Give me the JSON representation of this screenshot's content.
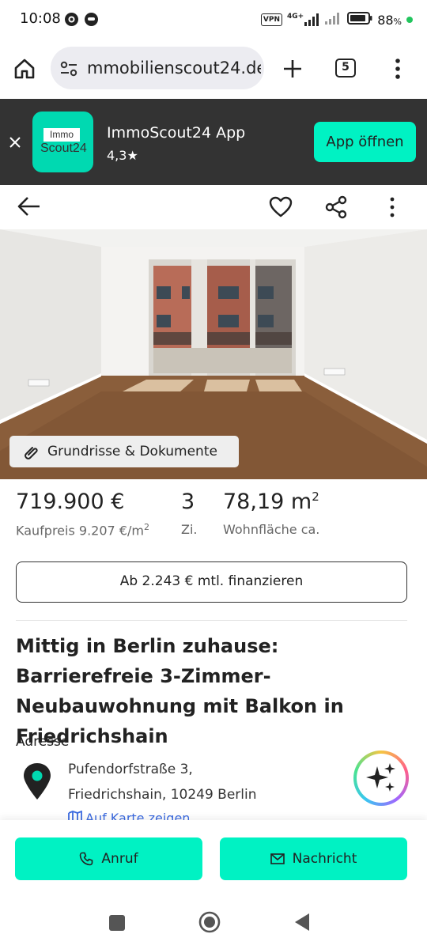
{
  "status_bar": {
    "time": "10:08",
    "vpn": "VPN",
    "network": "4G+",
    "battery": "88",
    "battery_unit": "%"
  },
  "browser": {
    "url": "mmobilienscout24.de",
    "tab_count": "5"
  },
  "app_banner": {
    "logo_top": "Immo",
    "logo_bottom": "Scout24",
    "name": "ImmoScout24 App",
    "rating": "4,3★",
    "open_label": "App öffnen",
    "brand_color": "#00f2c3",
    "banner_bg": "#333333"
  },
  "gallery": {
    "chip_label": "Grundrisse & Dokumente"
  },
  "listing": {
    "price": "719.900 €",
    "price_sub": "Kaufpreis 9.207 €/m",
    "rooms": "3",
    "rooms_sub": "Zi.",
    "area": "78,19 m",
    "area_sub": "Wohnfläche ca.",
    "sup_2": "2",
    "finance_label": "Ab 2.243 € mtl. finanzieren",
    "title": "Mittig in Berlin zuhause: Barrierefreie 3-Zimmer-Neubauwohnung mit Balkon in Friedrichshain",
    "address_label": "Adresse",
    "address_line1": "Pufendorfstraße 3,",
    "address_line2": "Friedrichshain, 10249 Berlin",
    "map_link": "Auf Karte zeigen"
  },
  "cta": {
    "call_label": "Anruf",
    "message_label": "Nachricht"
  },
  "icons": {
    "home": "home-icon",
    "site_settings": "site-settings-icon",
    "new_tab": "plus-icon",
    "tabs": "tab-switcher-icon",
    "menu": "more-vertical-icon",
    "close": "close-icon",
    "back": "arrow-left-icon",
    "favorite": "heart-icon",
    "share": "share-icon",
    "more": "more-vertical-icon",
    "attachment": "paperclip-icon",
    "location": "map-pin-icon",
    "map": "map-icon",
    "ai": "sparkles-icon",
    "phone": "phone-icon",
    "message": "envelope-icon"
  }
}
